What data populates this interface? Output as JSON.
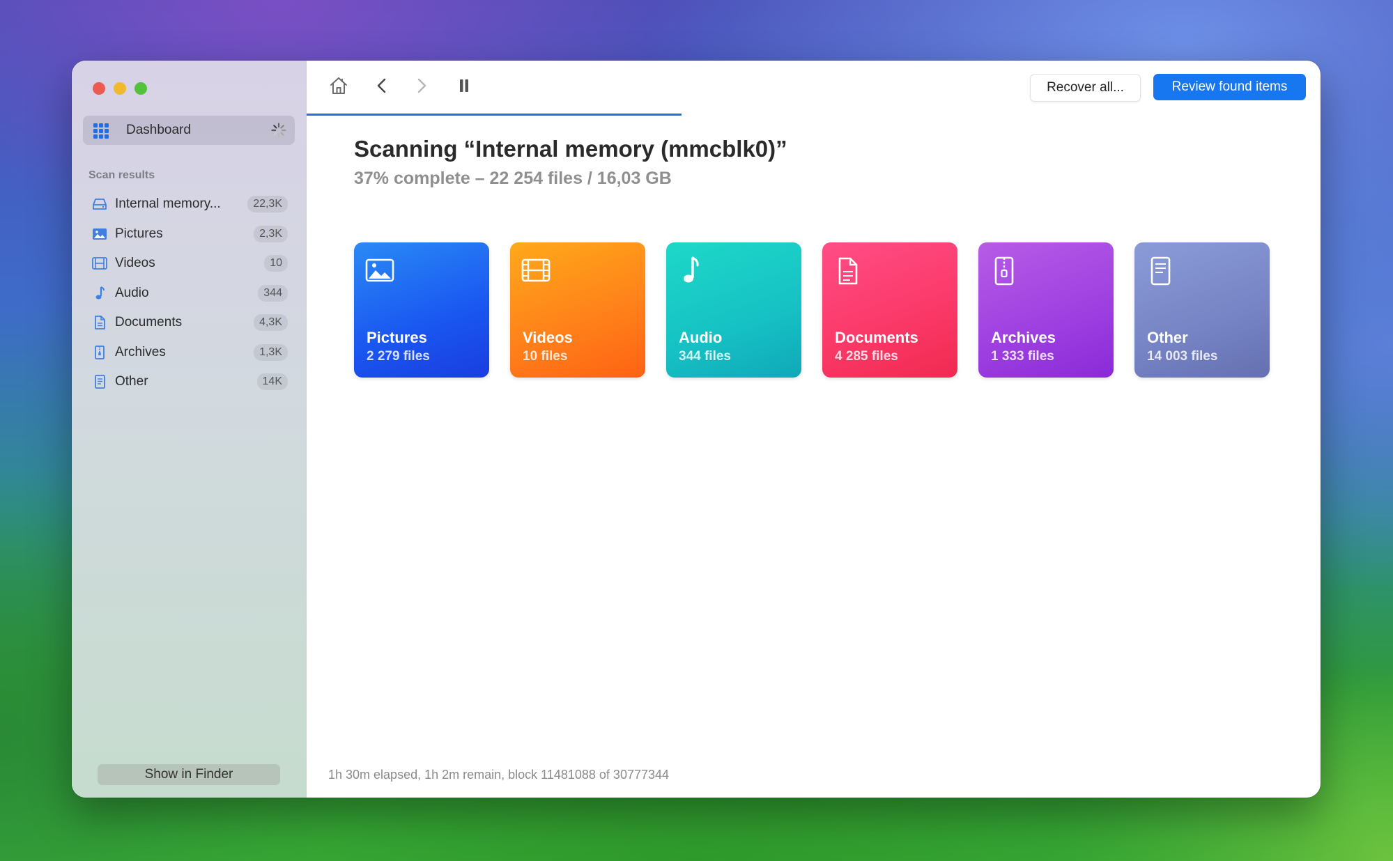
{
  "sidebar": {
    "dashboard_label": "Dashboard",
    "section_title": "Scan results",
    "items": [
      {
        "label": "Internal memory...",
        "count": "22,3K",
        "icon": "drive-icon"
      },
      {
        "label": "Pictures",
        "count": "2,3K",
        "icon": "picture-icon"
      },
      {
        "label": "Videos",
        "count": "10",
        "icon": "film-icon"
      },
      {
        "label": "Audio",
        "count": "344",
        "icon": "music-note-icon"
      },
      {
        "label": "Documents",
        "count": "4,3K",
        "icon": "document-icon"
      },
      {
        "label": "Archives",
        "count": "1,3K",
        "icon": "archive-icon"
      },
      {
        "label": "Other",
        "count": "14K",
        "icon": "other-file-icon"
      }
    ],
    "show_in_finder": "Show in Finder"
  },
  "toolbar": {
    "recover_all": "Recover all...",
    "review_found": "Review found items",
    "progress_fraction": 0.37
  },
  "main": {
    "title": "Scanning “Internal memory (mmcblk0)”",
    "subtitle": "37% complete – 22 254 files / 16,03 GB",
    "cards": [
      {
        "name": "Pictures",
        "count": "2 279 files"
      },
      {
        "name": "Videos",
        "count": "10 files"
      },
      {
        "name": "Audio",
        "count": "344 files"
      },
      {
        "name": "Documents",
        "count": "4 285 files"
      },
      {
        "name": "Archives",
        "count": "1 333 files"
      },
      {
        "name": "Other",
        "count": "14 003 files"
      }
    ],
    "status": "1h 30m elapsed, 1h 2m remain, block 11481088 of 30777344"
  },
  "colors": {
    "accent": "#1677f0",
    "pictures": "#1a56f0",
    "videos": "#ff7f1a",
    "audio": "#16c1c4",
    "documents": "#fa3867",
    "archives": "#9d3fe0",
    "other": "#7683c4"
  }
}
